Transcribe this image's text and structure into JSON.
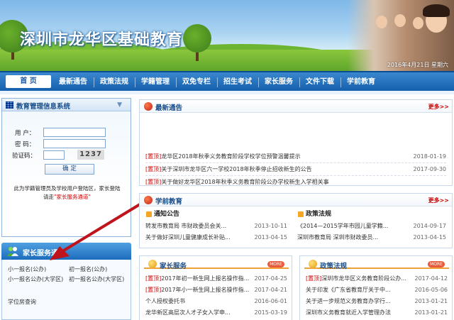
{
  "banner": {
    "title": "深圳市龙华区基础教育",
    "date": "2016年4月21日 星期六"
  },
  "nav": {
    "items": [
      "首 页",
      "最新通告",
      "政策法规",
      "学籍管理",
      "双免专栏",
      "招生考试",
      "家长服务",
      "文件下载",
      "学前教育"
    ]
  },
  "login": {
    "title": "教育管理信息系统",
    "user_label": "用 户：",
    "password_label": "密 码：",
    "captcha_label": "验证码：",
    "captcha_value": "1237",
    "submit": "确 定",
    "note_line1": "此为学籍管理员及学校用户登陆区，家长登陆",
    "note_prefix": "请走",
    "note_link": "\"家长服务通道\""
  },
  "family": {
    "title": "家长服务通道",
    "links": [
      "小一报名(公办)",
      "初一报名(公办)",
      "小一报名公办(大学区)",
      "初一报名公办(大学区)",
      "学位房查询"
    ]
  },
  "latest": {
    "title": "最新通告",
    "more": "更多>>",
    "items": [
      {
        "tag": "[置顶]",
        "text": "龙华区2018年秋季义务教育阶段学校学位预警温馨提示",
        "date": "2018-01-19"
      },
      {
        "tag": "[置顶]",
        "text": "关于深圳市龙华区六一学校2018年秋季停止招收新生的公告",
        "date": "2017-09-30"
      },
      {
        "tag": "[置顶]",
        "text": "关于做好龙华区2018年秋季义务教育阶段公办学校新生入学相关事",
        "date": ""
      }
    ]
  },
  "preschool": {
    "title": "学前教育",
    "more": "更多>>",
    "notice_title": "通知公告",
    "policy_title": "政策法规",
    "notices": [
      {
        "text": "转发市教育局 市财政委员会关...",
        "date": "2013-10-11"
      },
      {
        "text": "关于做好深圳儿童健康成长补贴...",
        "date": "2013-04-15"
      }
    ],
    "policies": [
      {
        "text": "《2014—2015学年市园儿童学籍...",
        "date": "2014-09-17"
      },
      {
        "text": "深圳市教育局 深圳市财政委员...",
        "date": "2013-04-15"
      }
    ]
  },
  "parents": {
    "title": "家长服务",
    "tag": "MORE",
    "items": [
      {
        "tag": "[置顶]",
        "text": "2017年初一新生网上报名操作指...",
        "date": "2017-04-25"
      },
      {
        "tag": "[置顶]",
        "text": "2017年小一新生网上报名操作指...",
        "date": "2017-04-21"
      },
      {
        "tag": "",
        "text": "个人授权委托书",
        "date": "2016-06-01"
      },
      {
        "tag": "",
        "text": "龙华新区高层次人才子女入学申...",
        "date": "2015-03-19"
      }
    ]
  },
  "policy": {
    "title": "政策法规",
    "tag": "MORE",
    "items": [
      {
        "tag": "[置顶]",
        "text": "深圳市龙华区义务教育阶段公办...",
        "date": "2017-04-12"
      },
      {
        "tag": "",
        "text": "关于印发《广东省教育厅关于中...",
        "date": "2016-05-06"
      },
      {
        "tag": "",
        "text": "关于进一步规范义务教育办学行...",
        "date": "2013-01-21"
      },
      {
        "tag": "",
        "text": "深圳市义务教育就近入学管理办法",
        "date": "2013-01-21"
      }
    ]
  }
}
